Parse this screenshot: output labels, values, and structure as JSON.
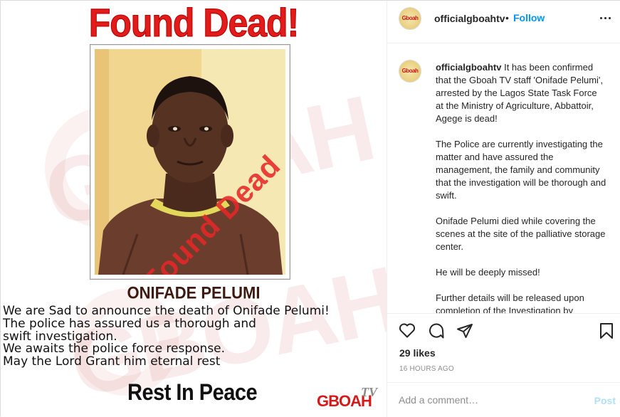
{
  "poster": {
    "headline": "Found Dead!",
    "stamp": "Found Dead",
    "person_name": "ONIFADE PELUMI",
    "announcement_lines": [
      "We are Sad to announce the death of Onifade Pelumi!",
      "The police has assured us a thorough and",
      "swift investigation.",
      "We awaits the police force response.",
      "May the Lord Grant him eternal rest"
    ],
    "closing": "Rest In Peace",
    "logo_main": "GBOAH",
    "logo_tv": "TV",
    "watermark": "GBOAH"
  },
  "header": {
    "avatar_text": "Gboah",
    "username": "officialgboahtv",
    "separator": "•",
    "follow_label": "Follow"
  },
  "caption": {
    "avatar_text": "Gboah",
    "username": "officialgboahtv",
    "paragraphs": [
      "It has been confirmed that the Gboah TV staff 'Onifade Pelumi', arrested by the Lagos State Task Force at the Ministry of Agriculture, Abbattoir, Agege is dead!",
      "The Police are currently investigating the matter and have assured the management, the family and community that the investigation will be thorough and swift.",
      "Onifade Pelumi died while covering the scenes at the site of the palliative storage center.",
      "He will be deeply missed!",
      "Further details will be released upon completion of the Investigation by"
    ]
  },
  "actions": {
    "icons": [
      "heart-icon",
      "comment-icon",
      "share-icon",
      "bookmark-icon"
    ],
    "likes": "29 likes",
    "timestamp": "16 HOURS AGO"
  },
  "comment": {
    "placeholder": "Add a comment…",
    "post_label": "Post"
  },
  "colors": {
    "headline_red": "#e21b1b",
    "follow_blue": "#0095f6",
    "post_disabled": "#b2dffc",
    "muted": "#8e8e8e"
  }
}
